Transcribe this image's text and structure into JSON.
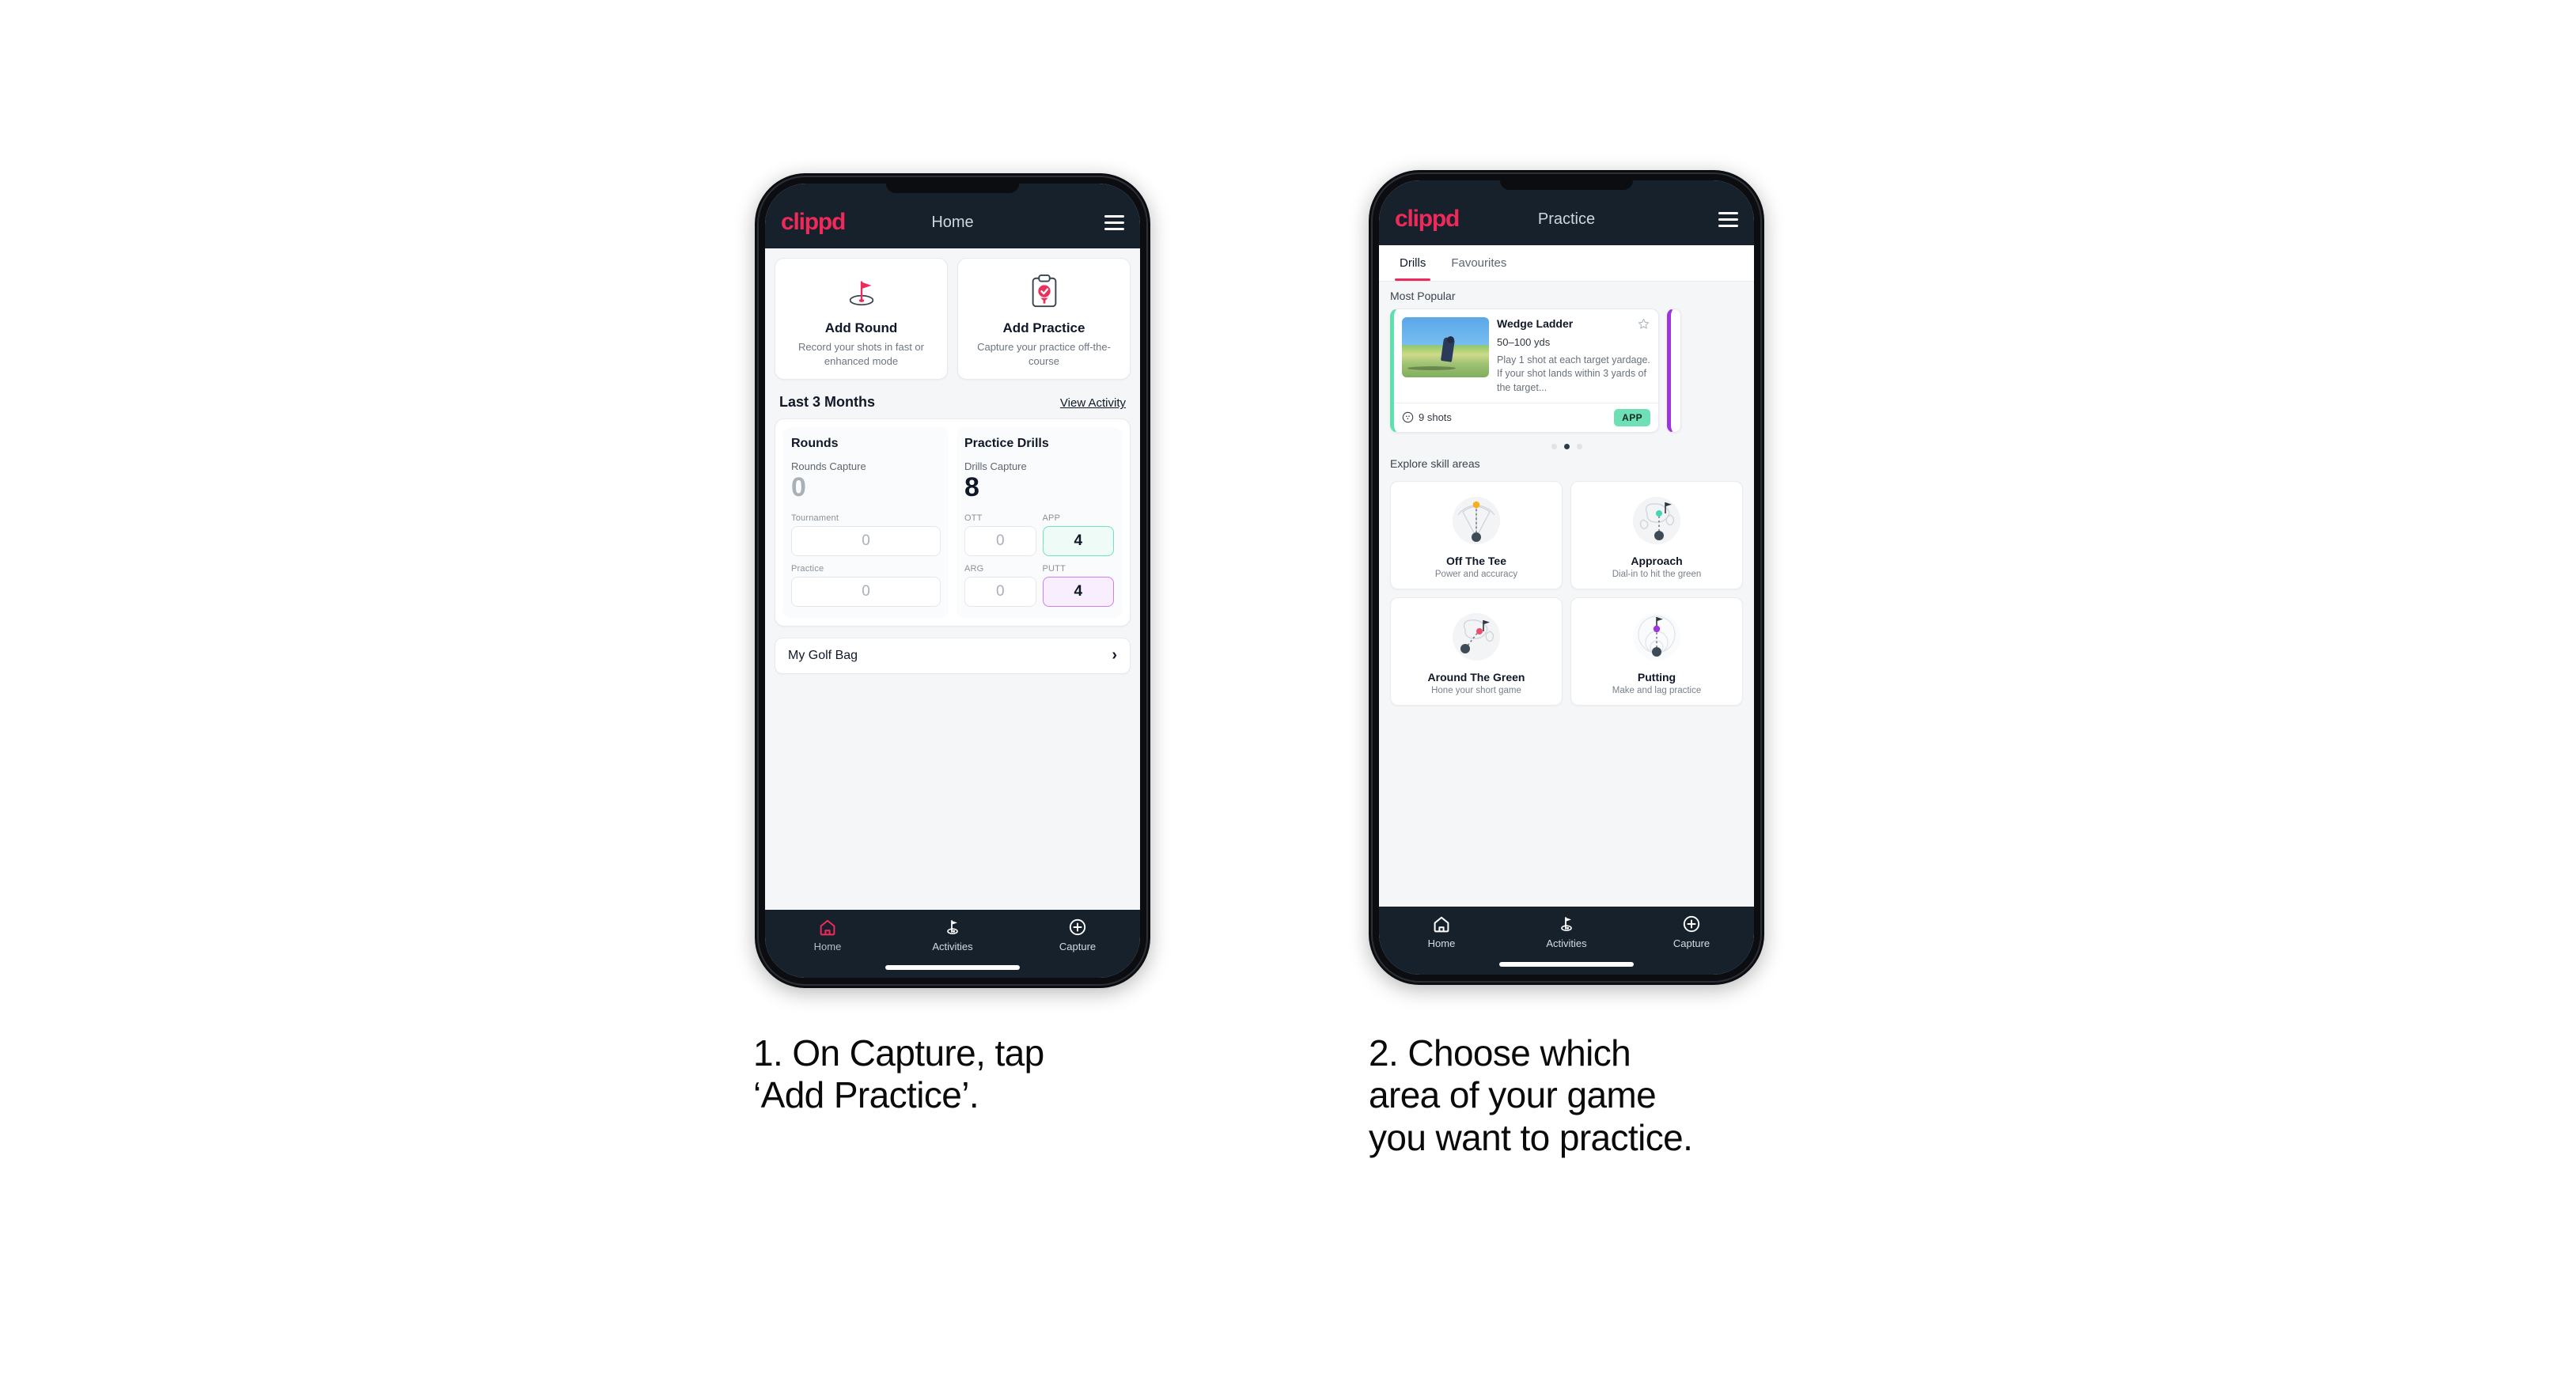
{
  "brand": "clippd",
  "phone1": {
    "header": {
      "title": "Home",
      "menu": "menu"
    },
    "actions": [
      {
        "title": "Add Round",
        "desc": "Record your shots in fast or enhanced mode",
        "icon": "golf-flag-icon"
      },
      {
        "title": "Add Practice",
        "desc": "Capture your practice off-the-course",
        "icon": "clipboard-check-icon"
      }
    ],
    "section": {
      "title": "Last 3 Months",
      "link": "View Activity"
    },
    "rounds": {
      "heading": "Rounds",
      "capture_label": "Rounds Capture",
      "capture_value": "0",
      "tournament_label": "Tournament",
      "tournament_value": "0",
      "practice_label": "Practice",
      "practice_value": "0"
    },
    "drills": {
      "heading": "Practice Drills",
      "capture_label": "Drills Capture",
      "capture_value": "8",
      "ott_label": "OTT",
      "ott_value": "0",
      "app_label": "APP",
      "app_value": "4",
      "arg_label": "ARG",
      "arg_value": "0",
      "putt_label": "PUTT",
      "putt_value": "4"
    },
    "golf_bag": {
      "label": "My Golf Bag",
      "chevron": "chevron-right-icon"
    },
    "nav": [
      {
        "label": "Home",
        "icon": "home-icon",
        "active": true
      },
      {
        "label": "Activities",
        "icon": "golf-flag-icon",
        "active": false
      },
      {
        "label": "Capture",
        "icon": "plus-circle-icon",
        "active": false
      }
    ]
  },
  "phone2": {
    "header": {
      "title": "Practice",
      "menu": "menu"
    },
    "tabs": [
      {
        "label": "Drills",
        "active": true
      },
      {
        "label": "Favourites",
        "active": false
      }
    ],
    "most_popular_label": "Most Popular",
    "drill": {
      "name": "Wedge Ladder",
      "yardage": "50–100 yds",
      "description": "Play 1 shot at each target yardage. If your shot lands within 3 yards of the target...",
      "shots": "9 shots",
      "badge": "APP",
      "badge_color": "#6fe0b5",
      "accent_color": "#5fe0b0",
      "star": "star-outline-icon"
    },
    "peek_accent_color": "#a033e0",
    "dots": {
      "count": 3,
      "active_index": 1
    },
    "explore_label": "Explore skill areas",
    "skills": [
      {
        "title": "Off The Tee",
        "sub": "Power and accuracy",
        "art": "tee-fan-icon",
        "dot_color": "#f6b01e"
      },
      {
        "title": "Approach",
        "sub": "Dial-in to hit the green",
        "art": "green-approach-icon",
        "dot_color": "#45d6b4"
      },
      {
        "title": "Around The Green",
        "sub": "Hone your short game",
        "art": "chip-icon",
        "dot_color": "#ef4d6e"
      },
      {
        "title": "Putting",
        "sub": "Make and lag practice",
        "art": "putting-rings-icon",
        "dot_color": "#a033e0"
      }
    ],
    "nav": [
      {
        "label": "Home",
        "icon": "home-icon",
        "active": false
      },
      {
        "label": "Activities",
        "icon": "golf-flag-icon",
        "active": false
      },
      {
        "label": "Capture",
        "icon": "plus-circle-icon",
        "active": false
      }
    ]
  },
  "captions": {
    "one": "1. On Capture, tap\n‘Add Practice’.",
    "two": "2. Choose which\narea of your game\nyou want to practice."
  },
  "colors": {
    "brand_pink": "#ef2a5b",
    "header_dark": "#16212c",
    "page_bg": "#f4f6f8",
    "green_accent": "#6fe2b8",
    "purple_accent": "#d07ff0"
  }
}
